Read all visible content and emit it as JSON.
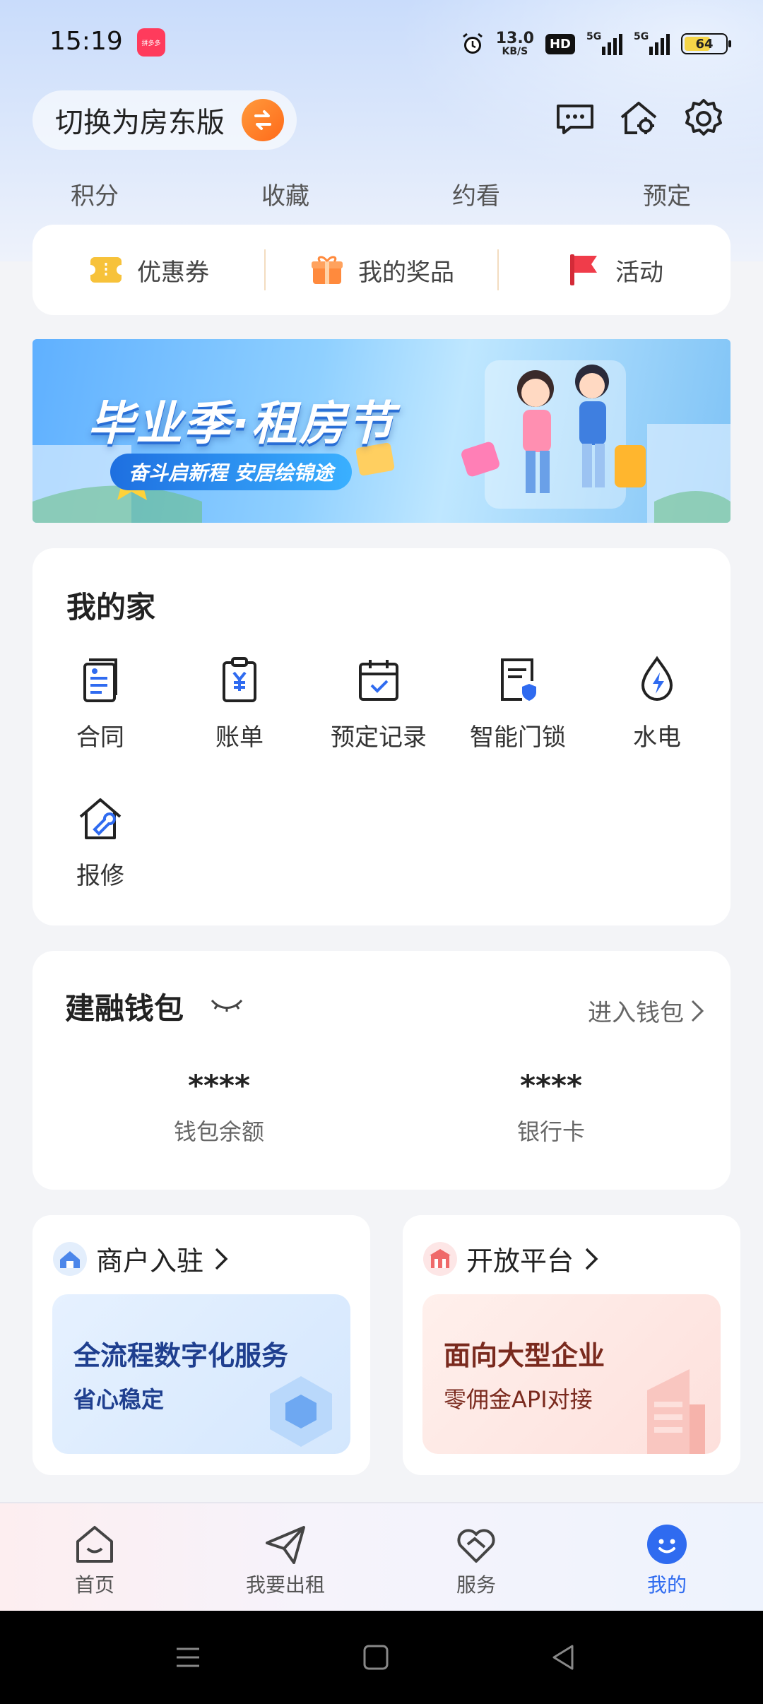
{
  "status": {
    "time": "15:19",
    "app_badge": "拼多多",
    "speed_value": "13.0",
    "speed_unit": "KB/S",
    "hd": "HD",
    "signal_1": "5G",
    "signal_2": "5G",
    "battery": "64",
    "battery_level": 0.64
  },
  "header": {
    "switch_label": "切换为房东版"
  },
  "quick_links": [
    "积分",
    "收藏",
    "约看",
    "预定"
  ],
  "rewards": [
    {
      "label": "优惠券",
      "icon": "coupon-icon",
      "color": "#f7c23a"
    },
    {
      "label": "我的奖品",
      "icon": "gift-icon",
      "color": "#ff8a3d"
    },
    {
      "label": "活动",
      "icon": "flag-icon",
      "color": "#f03c4a"
    }
  ],
  "banner": {
    "title": "毕业季·租房节",
    "subtitle": "奋斗启新程 安居绘锦途"
  },
  "my_home": {
    "title": "我的家",
    "items": [
      {
        "label": "合同",
        "icon": "contract-icon"
      },
      {
        "label": "账单",
        "icon": "bill-icon"
      },
      {
        "label": "预定记录",
        "icon": "booking-record-icon"
      },
      {
        "label": "智能门锁",
        "icon": "smart-lock-icon"
      },
      {
        "label": "水电",
        "icon": "utilities-icon"
      },
      {
        "label": "报修",
        "icon": "repair-icon"
      }
    ]
  },
  "wallet": {
    "title": "建融钱包",
    "enter_label": "进入钱包",
    "balance_value": "****",
    "balance_label": "钱包余额",
    "card_value": "****",
    "card_label": "银行卡"
  },
  "promos": [
    {
      "title": "商户入驻",
      "headline": "全流程数字化服务",
      "sub": "省心稳定",
      "accent": "#1f3f8f"
    },
    {
      "title": "开放平台",
      "headline": "面向大型企业",
      "sub": "零佣金API对接",
      "accent": "#7a2a1e"
    }
  ],
  "tabbar": [
    {
      "label": "首页",
      "icon": "home-icon",
      "active": false
    },
    {
      "label": "我要出租",
      "icon": "send-icon",
      "active": false
    },
    {
      "label": "服务",
      "icon": "handshake-heart-icon",
      "active": false
    },
    {
      "label": "我的",
      "icon": "smile-icon",
      "active": true
    }
  ],
  "colors": {
    "accent_blue": "#2f6bf0",
    "brand_orange": "#ff7a1f"
  }
}
